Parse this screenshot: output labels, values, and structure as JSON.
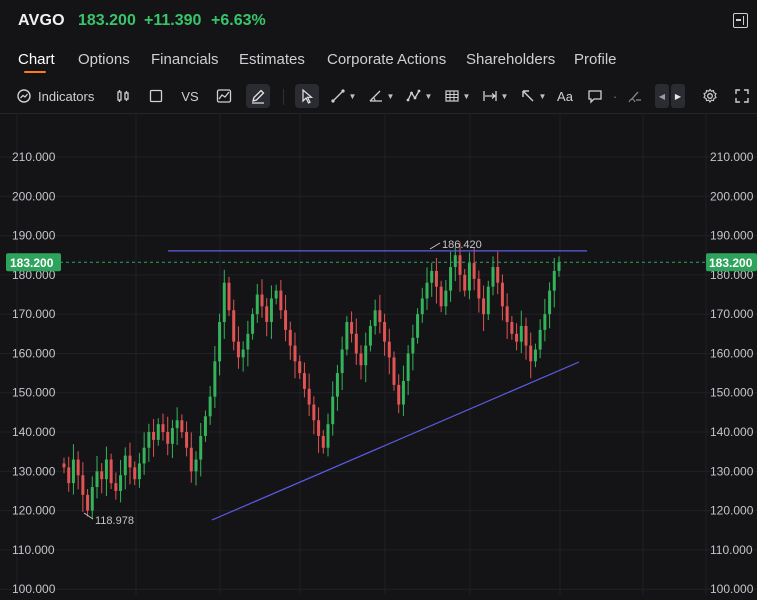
{
  "header": {
    "ticker": "AVGO",
    "price": "183.200",
    "change": "+11.390",
    "change_pct": "+6.63%",
    "up_color": "#38c46a"
  },
  "tabs": [
    {
      "label": "Chart",
      "active": true
    },
    {
      "label": "Options"
    },
    {
      "label": "Financials"
    },
    {
      "label": "Estimates"
    },
    {
      "label": "Corporate Actions"
    },
    {
      "label": "Shareholders"
    },
    {
      "label": "Profile"
    }
  ],
  "toolbar": {
    "indicators_label": "Indicators",
    "compare_label": "VS",
    "text_tool_label": "Aa",
    "icons": [
      "indicators-icon",
      "candlestick-icon",
      "square-icon",
      "compare-vs",
      "area-chart-icon",
      "draw-pen-icon",
      "cursor-arrow-icon",
      "trend-line-icon",
      "angle-line-icon",
      "pattern-icon",
      "fib-grid-icon",
      "measure-icon",
      "arrow-tool-icon",
      "text-tool",
      "comment-icon",
      "eraser-icon",
      "scroll-left-icon",
      "scroll-right-icon",
      "settings-gear-icon",
      "fullscreen-icon"
    ]
  },
  "chart_data": {
    "type": "candlestick",
    "symbol": "AVGO",
    "ylim": [
      100,
      212
    ],
    "y_ticks": [
      "210.000",
      "200.000",
      "190.000",
      "180.000",
      "170.000",
      "160.000",
      "150.000",
      "140.000",
      "130.000",
      "120.000",
      "110.000",
      "100.000"
    ],
    "last_price_label": "183.200",
    "last_price": 183.2,
    "annotations": {
      "high_label": "186.420",
      "low_label": "118.978"
    },
    "grid": true,
    "colors": {
      "up": "#34b35a",
      "down": "#e05454",
      "trendline": "#5b5ce6",
      "price_line": "#2ea35b"
    }
  }
}
